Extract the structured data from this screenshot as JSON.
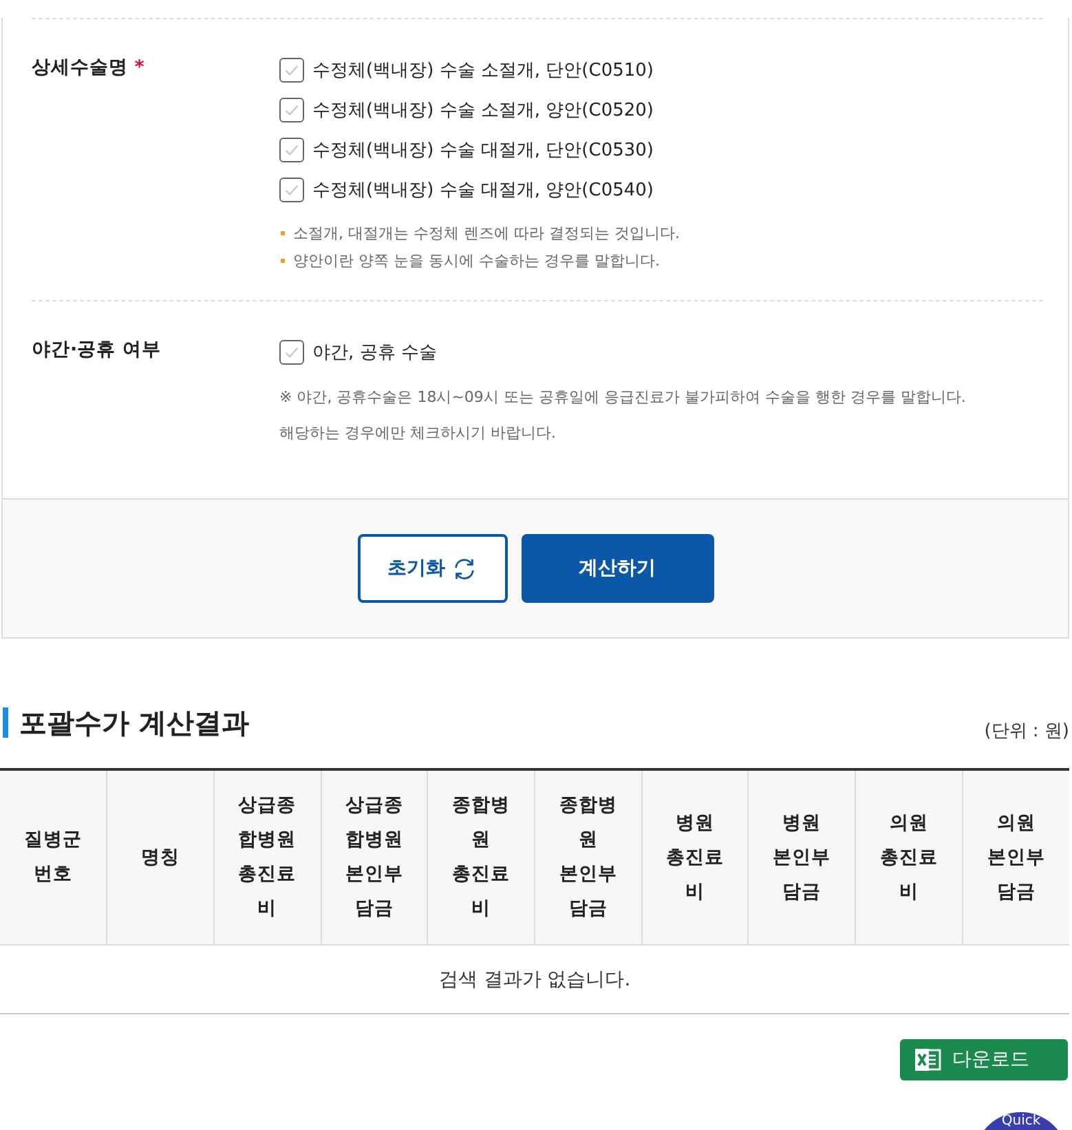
{
  "form": {
    "rows": [
      {
        "label": "상세수술명",
        "required_mark": "*",
        "options": [
          {
            "label": "수정체(백내장) 수술 소절개, 단안(C0510)",
            "checked": false
          },
          {
            "label": "수정체(백내장) 수술 소절개, 양안(C0520)",
            "checked": false
          },
          {
            "label": "수정체(백내장) 수술 대절개, 단안(C0530)",
            "checked": false
          },
          {
            "label": "수정체(백내장) 수술 대절개, 양안(C0540)",
            "checked": false
          }
        ],
        "notes": [
          {
            "kind": "bullet",
            "text": "소절개, 대절개는 수정체 렌즈에 따라 결정되는 것입니다."
          },
          {
            "kind": "bullet",
            "text": "양안이란 양쪽 눈을 동시에 수술하는 경우를 말합니다."
          }
        ]
      },
      {
        "label": "야간·공휴 여부",
        "options": [
          {
            "label": "야간, 공휴 수술",
            "checked": false
          }
        ],
        "notes": [
          {
            "kind": "plain",
            "text": "※ 야간, 공휴수술은 18시~09시 또는 공휴일에 응급진료가 불가피하여 수술을 행한 경우를 말합니다."
          },
          {
            "kind": "plain",
            "text": "해당하는 경우에만 체크하시기 바랍니다."
          }
        ]
      }
    ],
    "buttons": [
      {
        "label": "초기화",
        "kind": "reset"
      },
      {
        "label": "계산하기",
        "kind": "primary"
      }
    ]
  },
  "results": {
    "title": "포괄수가 계산결과",
    "unit": "(단위 : 원)",
    "columns": [
      "질병군 번호",
      "명칭",
      "상급종합병원 총진료비",
      "상급종합병원 본인부담금",
      "종합병원 총진료비",
      "종합병원 본인부담금",
      "병원 총진료비",
      "병원 본인부담금",
      "의원 총진료비",
      "의원 본인부담금"
    ],
    "empty_message": "검색 결과가 없습니다.",
    "download_button": "다운로드"
  },
  "quick_button": "Quick"
}
